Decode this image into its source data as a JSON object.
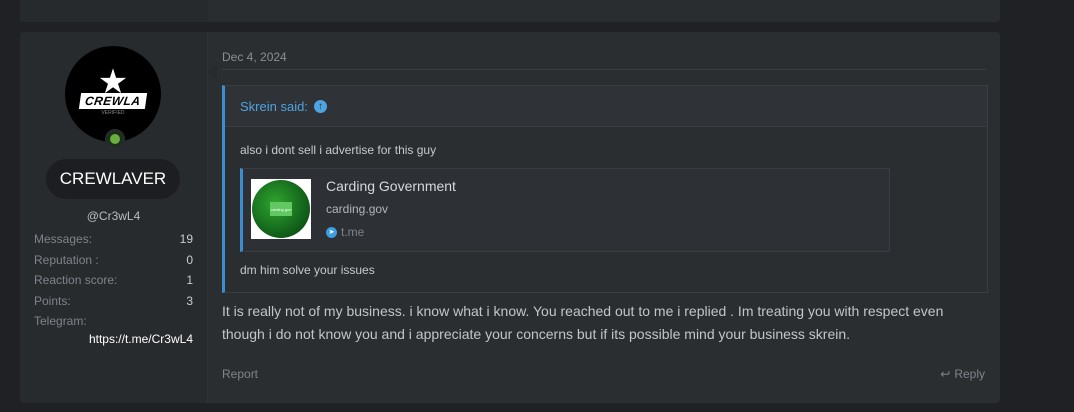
{
  "previous_post": {
    "telegram_link": "https://t.me/Cr3wL4"
  },
  "post": {
    "date": "Dec 4, 2024",
    "user": {
      "avatar_text": "CREWLA",
      "avatar_sub": "VERIFIED",
      "name": "CREWLAVER",
      "handle": "@Cr3wL4",
      "stats": [
        {
          "label": "Messages:",
          "value": "19"
        },
        {
          "label": "Reputation :",
          "value": "0"
        },
        {
          "label": "Reaction score:",
          "value": "1"
        },
        {
          "label": "Points:",
          "value": "3"
        }
      ],
      "telegram_label": "Telegram:",
      "telegram_value": "https://t.me/Cr3wL4"
    },
    "quote": {
      "author": "Skrein said:",
      "text1": "also i dont sell i advertise for this guy",
      "embed": {
        "title": "Carding Government",
        "domain": "carding.gov",
        "source": "t.me",
        "thumb_text": "carding.gov"
      },
      "text2": "dm him solve your issues"
    },
    "body": "It is really not of my business. i know what i know. You reached out to me i replied . Im treating you with respect even though i do not know you and i appreciate your concerns but if its possible mind your business skrein.",
    "actions": {
      "report": "Report",
      "reply": "Reply"
    }
  },
  "colors": {
    "accent": "#3b8fd0",
    "online": "#68b03c",
    "background": "#1f2124"
  }
}
